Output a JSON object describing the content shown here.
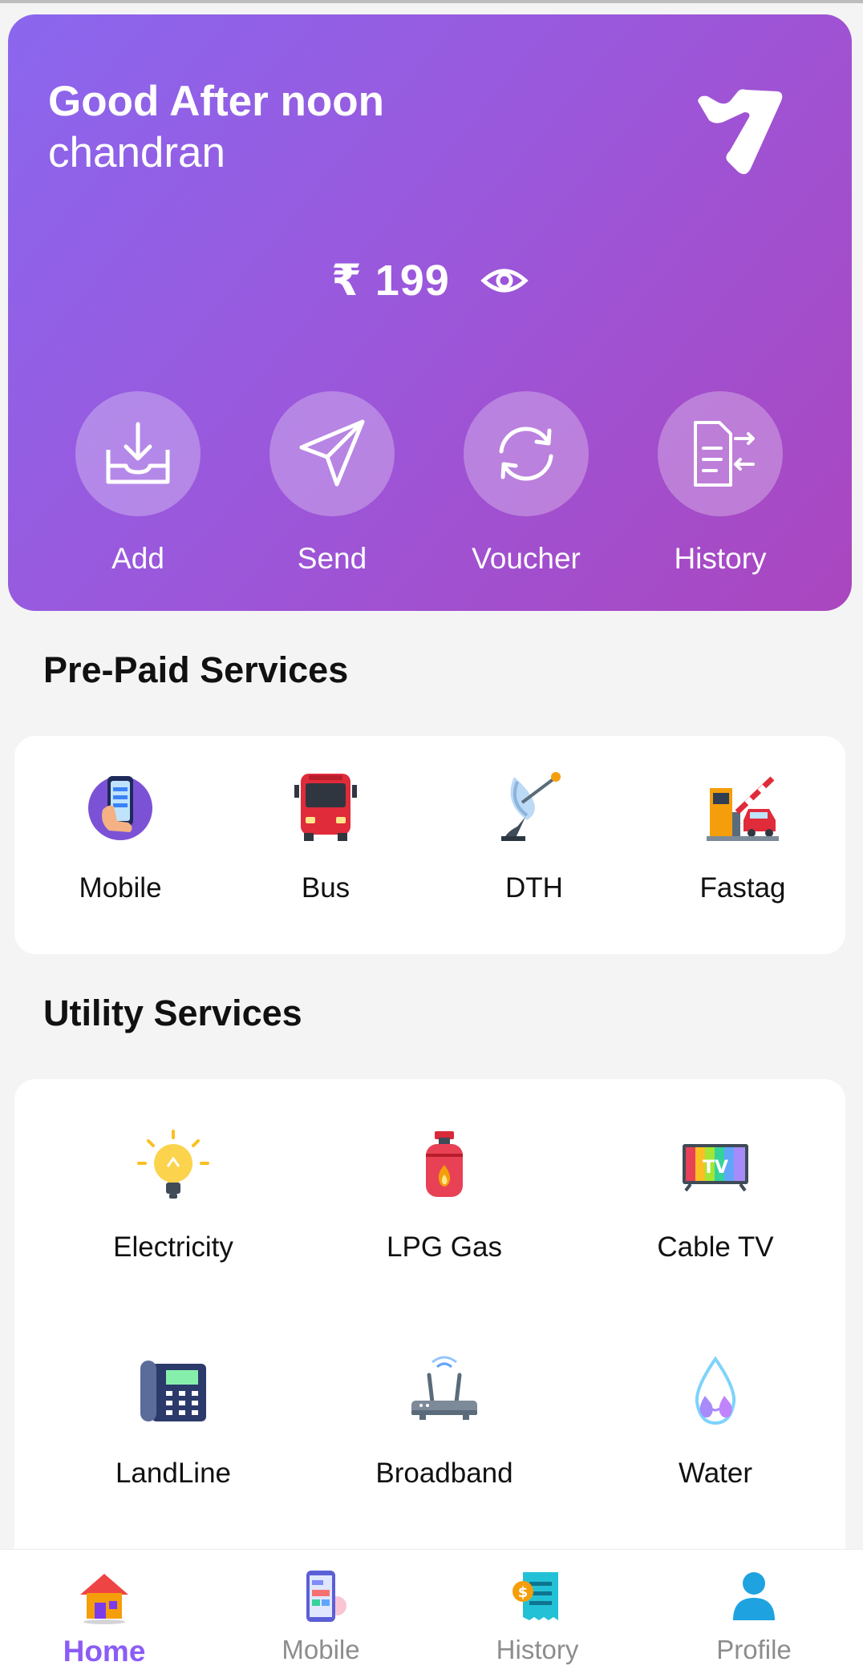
{
  "header": {
    "greeting": "Good After noon",
    "user_name": "chandran",
    "balance": "₹ 199",
    "accent_gradient": [
      "#8a67ee",
      "#aa46bf"
    ]
  },
  "quick_actions": [
    {
      "label": "Add",
      "icon": "download-tray-icon"
    },
    {
      "label": "Send",
      "icon": "paper-plane-icon"
    },
    {
      "label": "Voucher",
      "icon": "refresh-icon"
    },
    {
      "label": "History",
      "icon": "document-transfer-icon"
    }
  ],
  "prepaid": {
    "title": "Pre-Paid Services",
    "items": [
      {
        "label": "Mobile",
        "icon": "mobile-phone-icon"
      },
      {
        "label": "Bus",
        "icon": "bus-icon"
      },
      {
        "label": "DTH",
        "icon": "satellite-dish-icon"
      },
      {
        "label": "Fastag",
        "icon": "toll-gate-icon"
      }
    ]
  },
  "utility": {
    "title": "Utility Services",
    "items": [
      {
        "label": "Electricity",
        "icon": "light-bulb-icon"
      },
      {
        "label": "LPG Gas",
        "icon": "gas-cylinder-icon"
      },
      {
        "label": "Cable TV",
        "icon": "tv-icon"
      },
      {
        "label": "LandLine",
        "icon": "telephone-icon"
      },
      {
        "label": "Broadband",
        "icon": "router-icon"
      },
      {
        "label": "Water",
        "icon": "water-drop-icon"
      }
    ]
  },
  "bottom_nav": {
    "active": "Home",
    "items": [
      {
        "label": "Home",
        "icon": "home-icon"
      },
      {
        "label": "Mobile",
        "icon": "mobile-icon"
      },
      {
        "label": "History",
        "icon": "receipt-icon"
      },
      {
        "label": "Profile",
        "icon": "profile-icon"
      }
    ]
  }
}
